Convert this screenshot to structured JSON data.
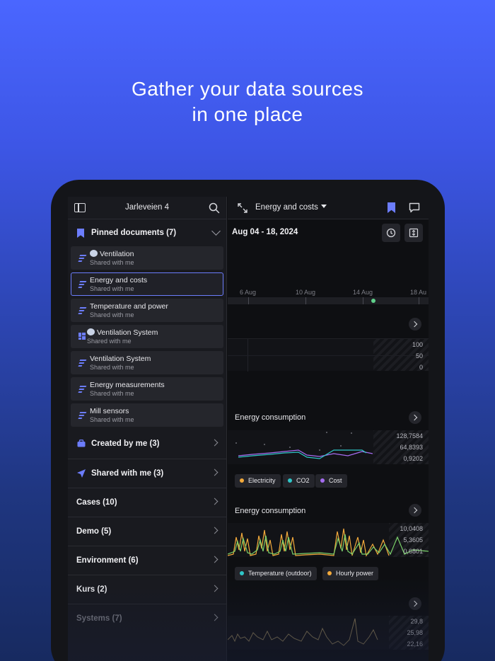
{
  "headline": {
    "line1": "Gather your data sources",
    "line2": "in one place"
  },
  "left_panel": {
    "title": "Jarleveien 4",
    "pinned": {
      "label": "Pinned documents (7)",
      "items": [
        {
          "name": "Ventilation",
          "sub": "Shared with me",
          "icon": "document-lines-icon"
        },
        {
          "name": "Energy and costs",
          "sub": "Shared with me",
          "icon": "document-lines-icon"
        },
        {
          "name": "Temperature and power",
          "sub": "Shared with me",
          "icon": "document-lines-icon"
        },
        {
          "name": "Ventilation System",
          "sub": "Shared with me",
          "icon": "dashboard-grid-icon"
        },
        {
          "name": "Ventilation System",
          "sub": "Shared with me",
          "icon": "document-lines-icon"
        },
        {
          "name": "Energy measurements",
          "sub": "Shared with me",
          "icon": "document-lines-icon"
        },
        {
          "name": "Mill sensors",
          "sub": "Shared with me",
          "icon": "document-lines-icon"
        }
      ]
    },
    "folders": [
      {
        "label": "Created by me (3)",
        "icon": "briefcase-icon"
      },
      {
        "label": "Shared with me (3)",
        "icon": "send-arrow-icon"
      },
      {
        "label": "Cases (10)"
      },
      {
        "label": "Demo (5)"
      },
      {
        "label": "Environment (6)"
      },
      {
        "label": "Kurs (2)"
      },
      {
        "label": "Systems (7)"
      }
    ]
  },
  "right_panel": {
    "dropdown": "Energy and costs",
    "date_range": "Aug 04 - 18, 2024",
    "timeline": [
      "6 Aug",
      "10 Aug",
      "14 Aug",
      "18 Au"
    ],
    "panel1": {
      "y_labels": [
        "100",
        "50",
        "0"
      ]
    },
    "panel2": {
      "title": "Energy consumption",
      "y_labels": [
        "128,7584",
        "64,8393",
        "0,9202"
      ],
      "legend": [
        {
          "name": "Electricity",
          "color": "#f2a93b"
        },
        {
          "name": "CO2",
          "color": "#2fc6c8"
        },
        {
          "name": "Cost",
          "color": "#a56cf0"
        }
      ]
    },
    "panel3": {
      "title": "Energy consumption",
      "y_labels": [
        "10,0408",
        "5,3605",
        "0,6801"
      ],
      "legend": [
        {
          "name": "Temperature (outdoor)",
          "color": "#2fc6c8"
        },
        {
          "name": "Hourly power",
          "color": "#f2a93b"
        }
      ]
    },
    "panel4": {
      "y_labels": [
        "29,8",
        "25,98",
        "22,16"
      ]
    }
  },
  "colors": {
    "accent": "#6c7dfc",
    "background_top": "#4a66ff",
    "panel": "#191a1f"
  }
}
